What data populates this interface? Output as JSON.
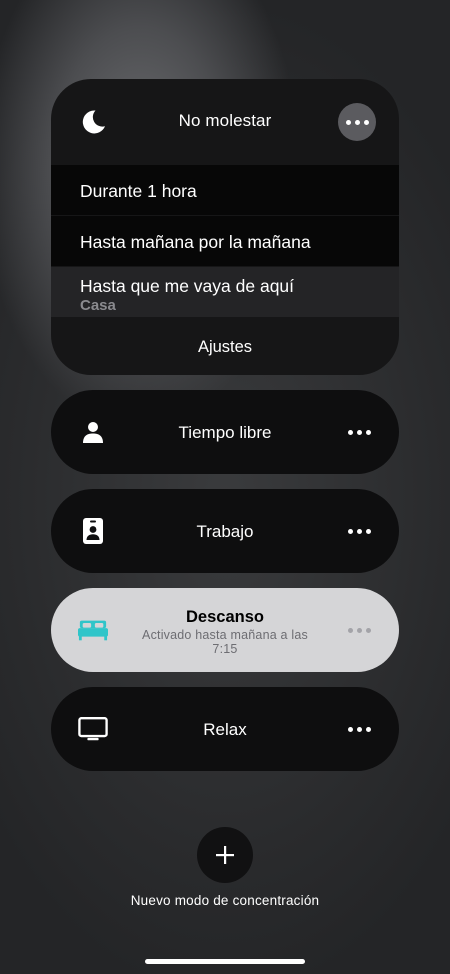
{
  "focus_card": {
    "icon": "moon-icon",
    "title": "No molestar",
    "more_icon": "ellipsis-icon",
    "options": [
      {
        "label": "Durante 1 hora"
      },
      {
        "label": "Hasta mañana por la mañana"
      },
      {
        "label": "Hasta que me vaya de aquí",
        "sublabel": "Casa"
      }
    ],
    "settings_label": "Ajustes"
  },
  "modes": [
    {
      "label": "Tiempo libre",
      "icon": "person-icon"
    },
    {
      "label": "Trabajo",
      "icon": "id-badge-icon"
    },
    {
      "label": "Descanso",
      "icon": "bed-icon",
      "active": true,
      "status": "Activado hasta mañana a las 7:15",
      "accent": "#30c5c9"
    },
    {
      "label": "Relax",
      "icon": "tv-icon"
    }
  ],
  "add_mode": {
    "icon": "plus-icon",
    "label": "Nuevo modo de concentración"
  },
  "colors": {
    "card_background": "#161617",
    "active_pill_background": "#d5d5d7",
    "accent_teal": "#30c5c9"
  }
}
